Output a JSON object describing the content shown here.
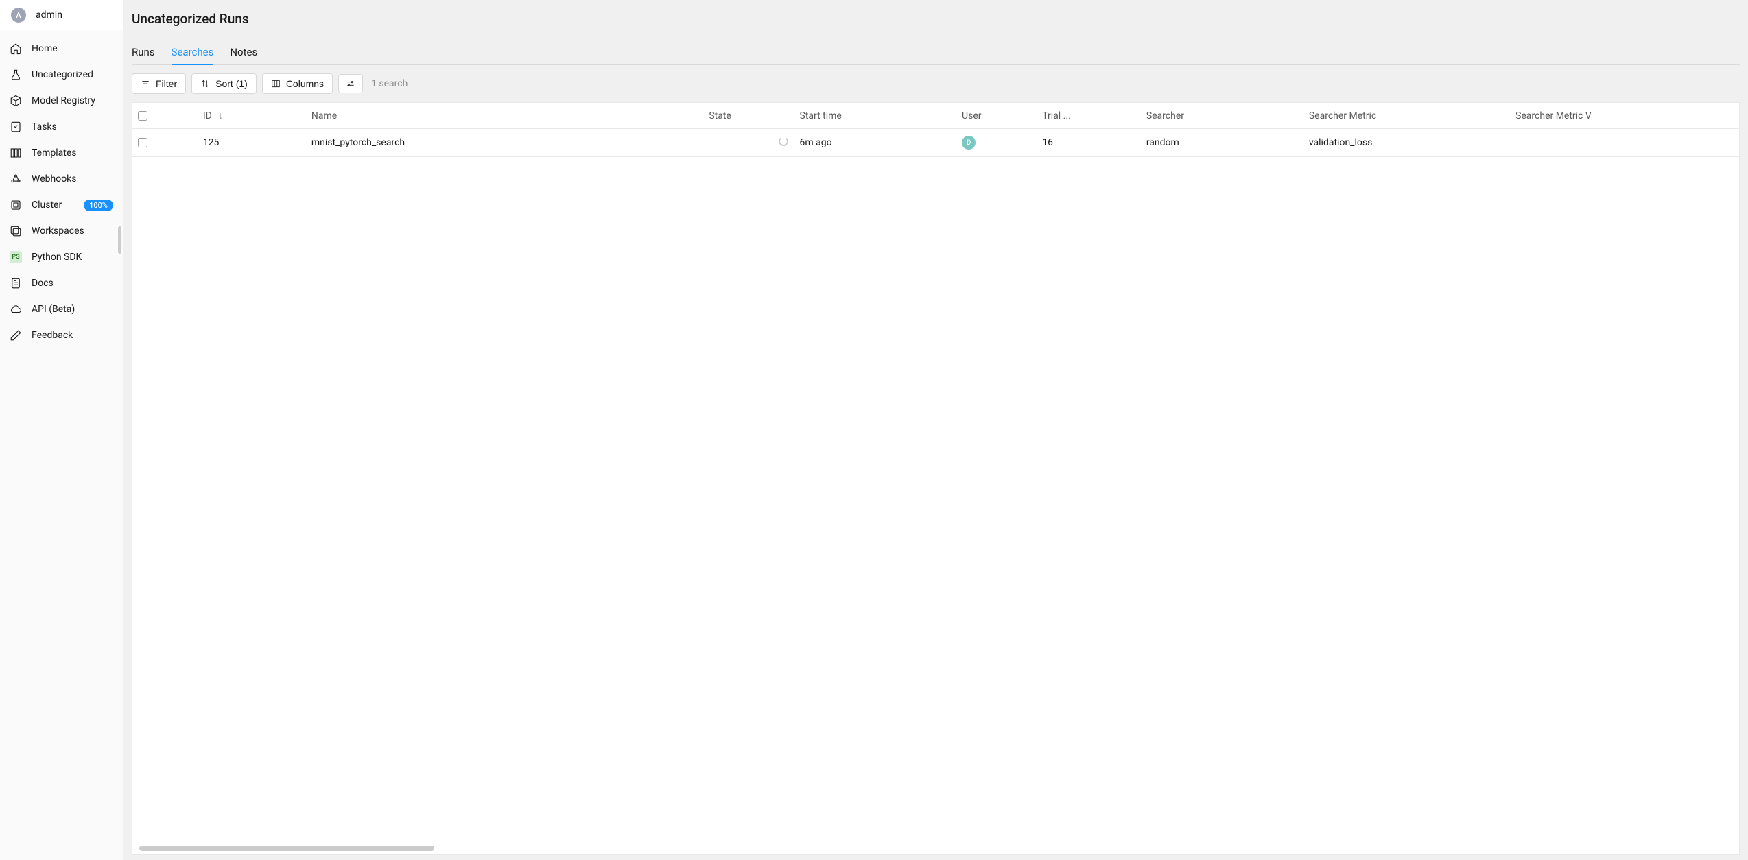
{
  "user": {
    "initial": "A",
    "name": "admin"
  },
  "sidebar": {
    "items": [
      {
        "label": "Home"
      },
      {
        "label": "Uncategorized"
      },
      {
        "label": "Model Registry"
      },
      {
        "label": "Tasks"
      },
      {
        "label": "Templates"
      },
      {
        "label": "Webhooks"
      },
      {
        "label": "Cluster",
        "badge": "100%"
      },
      {
        "label": "Workspaces"
      },
      {
        "label": "Python SDK",
        "ps": "PS"
      },
      {
        "label": "Docs"
      },
      {
        "label": "API (Beta)"
      },
      {
        "label": "Feedback"
      }
    ]
  },
  "page": {
    "title": "Uncategorized Runs"
  },
  "tabs": [
    {
      "label": "Runs"
    },
    {
      "label": "Searches"
    },
    {
      "label": "Notes"
    }
  ],
  "toolbar": {
    "filter": "Filter",
    "sort": "Sort (1)",
    "columns": "Columns",
    "count": "1 search"
  },
  "table": {
    "headers": {
      "id": "ID",
      "name": "Name",
      "state": "State",
      "start_time": "Start time",
      "user": "User",
      "trial": "Trial ...",
      "searcher": "Searcher",
      "searcher_metric": "Searcher Metric",
      "searcher_metric_val": "Searcher Metric V"
    },
    "rows": [
      {
        "id": "125",
        "name": "mnist_pytorch_search",
        "start_time": "6m ago",
        "user_initial": "D",
        "trial": "16",
        "searcher": "random",
        "searcher_metric": "validation_loss"
      }
    ]
  }
}
